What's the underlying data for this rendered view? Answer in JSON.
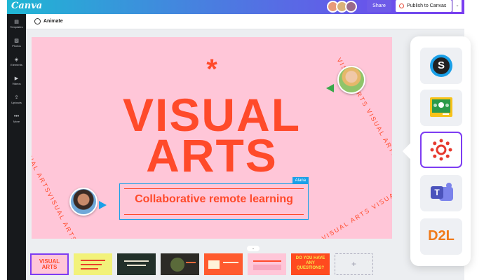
{
  "app": {
    "logo": "Canva"
  },
  "header": {
    "share_label": "Share",
    "publish_label": "Publish to Canvas",
    "publish_caret": "⌄"
  },
  "sidebar": {
    "items": [
      {
        "icon": "▤",
        "label": "Templates"
      },
      {
        "icon": "▨",
        "label": "Photos"
      },
      {
        "icon": "◈",
        "label": "Elements"
      },
      {
        "icon": "▶",
        "label": "Videos"
      },
      {
        "icon": "⇪",
        "label": "Uploads"
      },
      {
        "icon": "•••",
        "label": "More"
      }
    ]
  },
  "toolbar": {
    "animate_label": "Animate"
  },
  "slide": {
    "asterisk": "*",
    "title_line1": "VISUAL",
    "title_line2": "ARTS",
    "curved_text_left": "VISUAL ARTSVISUAL ARTS",
    "curved_text_right_top": "VISUAL ARTS VISUAL ARTS",
    "curved_text_right_bottom": "VISUAL ARTS VISUAL ARTS",
    "textbox_text": "Collaborative remote learning",
    "collaborator_tag": "Alana"
  },
  "filmstrip": {
    "handle": "⌄",
    "add_label": "+",
    "thumbs": [
      {
        "title": "VISUAL ARTS",
        "bg": "#ffc6d8",
        "fg": "#ff4a2a"
      },
      {
        "title": "",
        "bg": "#f2f27a",
        "fg": "#e8402a"
      },
      {
        "title": "",
        "bg": "#22302a",
        "fg": "#e7e3d0"
      },
      {
        "title": "",
        "bg": "#2c2a26",
        "fg": "#ff6a3a"
      },
      {
        "title": "",
        "bg": "#ff5a2e",
        "fg": "#fff2d8"
      },
      {
        "title": "",
        "bg": "#ffc6d8",
        "fg": "#ff4a2a"
      },
      {
        "title": "DO YOU HAVE ANY QUESTIONS?",
        "bg": "#ff4a1f",
        "fg": "#f5e94a"
      }
    ]
  },
  "integrations": {
    "items": [
      {
        "name": "Schoology"
      },
      {
        "name": "Google Classroom"
      },
      {
        "name": "Canvas",
        "selected": true
      },
      {
        "name": "Microsoft Teams"
      },
      {
        "name": "D2L"
      }
    ],
    "d2l_text": "D2L",
    "teams_text": "T"
  },
  "colors": {
    "accent": "#7d3cf2",
    "slide_bg": "#ffc6d8",
    "slide_text": "#ff4a2a",
    "selection_blue": "#1aa0e8"
  }
}
